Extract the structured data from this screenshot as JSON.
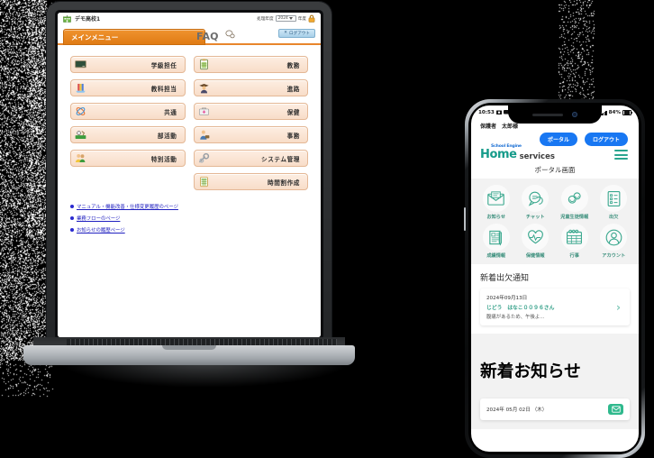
{
  "laptop": {
    "header": {
      "school_icon": "school-building-icon",
      "school_name": "デモ高校1",
      "year_label_before": "処理年度",
      "year_value": "2024",
      "year_label_after": "年度",
      "lock_icon": "lock-icon"
    },
    "tabs": [
      {
        "label": "メインメニュー",
        "active": true
      },
      {
        "label": "FAQ",
        "active": false
      }
    ],
    "logout": {
      "label": "ログアウト",
      "icon": "close-x-icon"
    },
    "menu_left": [
      {
        "label": "学級担任",
        "icon": "blackboard-icon"
      },
      {
        "label": "教科担当",
        "icon": "books-icon"
      },
      {
        "label": "共通",
        "icon": "atom-icon"
      },
      {
        "label": "部活動",
        "icon": "sports-field-icon"
      },
      {
        "label": "特別活動",
        "icon": "two-people-icon"
      }
    ],
    "menu_right": [
      {
        "label": "教務",
        "icon": "clipboard-green-icon"
      },
      {
        "label": "進路",
        "icon": "graduate-icon"
      },
      {
        "label": "保健",
        "icon": "first-aid-kit-icon"
      },
      {
        "label": "事務",
        "icon": "office-worker-icon"
      },
      {
        "label": "システム管理",
        "icon": "wrench-gear-icon"
      },
      {
        "label": "時間割作成",
        "icon": "timetable-icon"
      }
    ],
    "links": [
      "マニュアル・機能改善・仕様変更履歴のページ",
      "業務フローのページ",
      "お知らせの履歴ページ"
    ]
  },
  "phone": {
    "status": {
      "time": "10:53",
      "battery": "84%"
    },
    "user": "保護者　太郎様",
    "buttons": [
      {
        "label": "ポータル"
      },
      {
        "label": "ログアウト"
      }
    ],
    "logo": {
      "super": "School Engine",
      "main": "Home",
      "sub": "services"
    },
    "menu_icon": "hamburger-menu-icon",
    "page_title": "ポータル画面",
    "grid": [
      {
        "label": "お知らせ",
        "icon": "envelope-icon"
      },
      {
        "label": "チャット",
        "icon": "chat-bubbles-icon"
      },
      {
        "label": "児童生徒情報",
        "icon": "students-icon"
      },
      {
        "label": "出欠",
        "icon": "checklist-icon"
      },
      {
        "label": "成績情報",
        "icon": "report-pen-icon"
      },
      {
        "label": "保健情報",
        "icon": "heart-pulse-icon"
      },
      {
        "label": "行事",
        "icon": "calendar-icon"
      },
      {
        "label": "アカウント",
        "icon": "person-circle-icon"
      }
    ],
    "attendance": {
      "title": "新着出欠通知",
      "date": "2024年09月13日",
      "name": "じどう　はなこ００９６さん",
      "body": "腹痛があるため、午後よ...",
      "chevron": "chevron-right-icon"
    },
    "news": {
      "title": "新着お知らせ",
      "date": "2024年 05月 02日 （木）",
      "badge_icon": "mail-badge-icon"
    }
  },
  "colors": {
    "accent_orange": "#e8862c",
    "link_blue": "#2020c0",
    "phone_blue": "#1877f2",
    "teal": "#2fb98d"
  }
}
